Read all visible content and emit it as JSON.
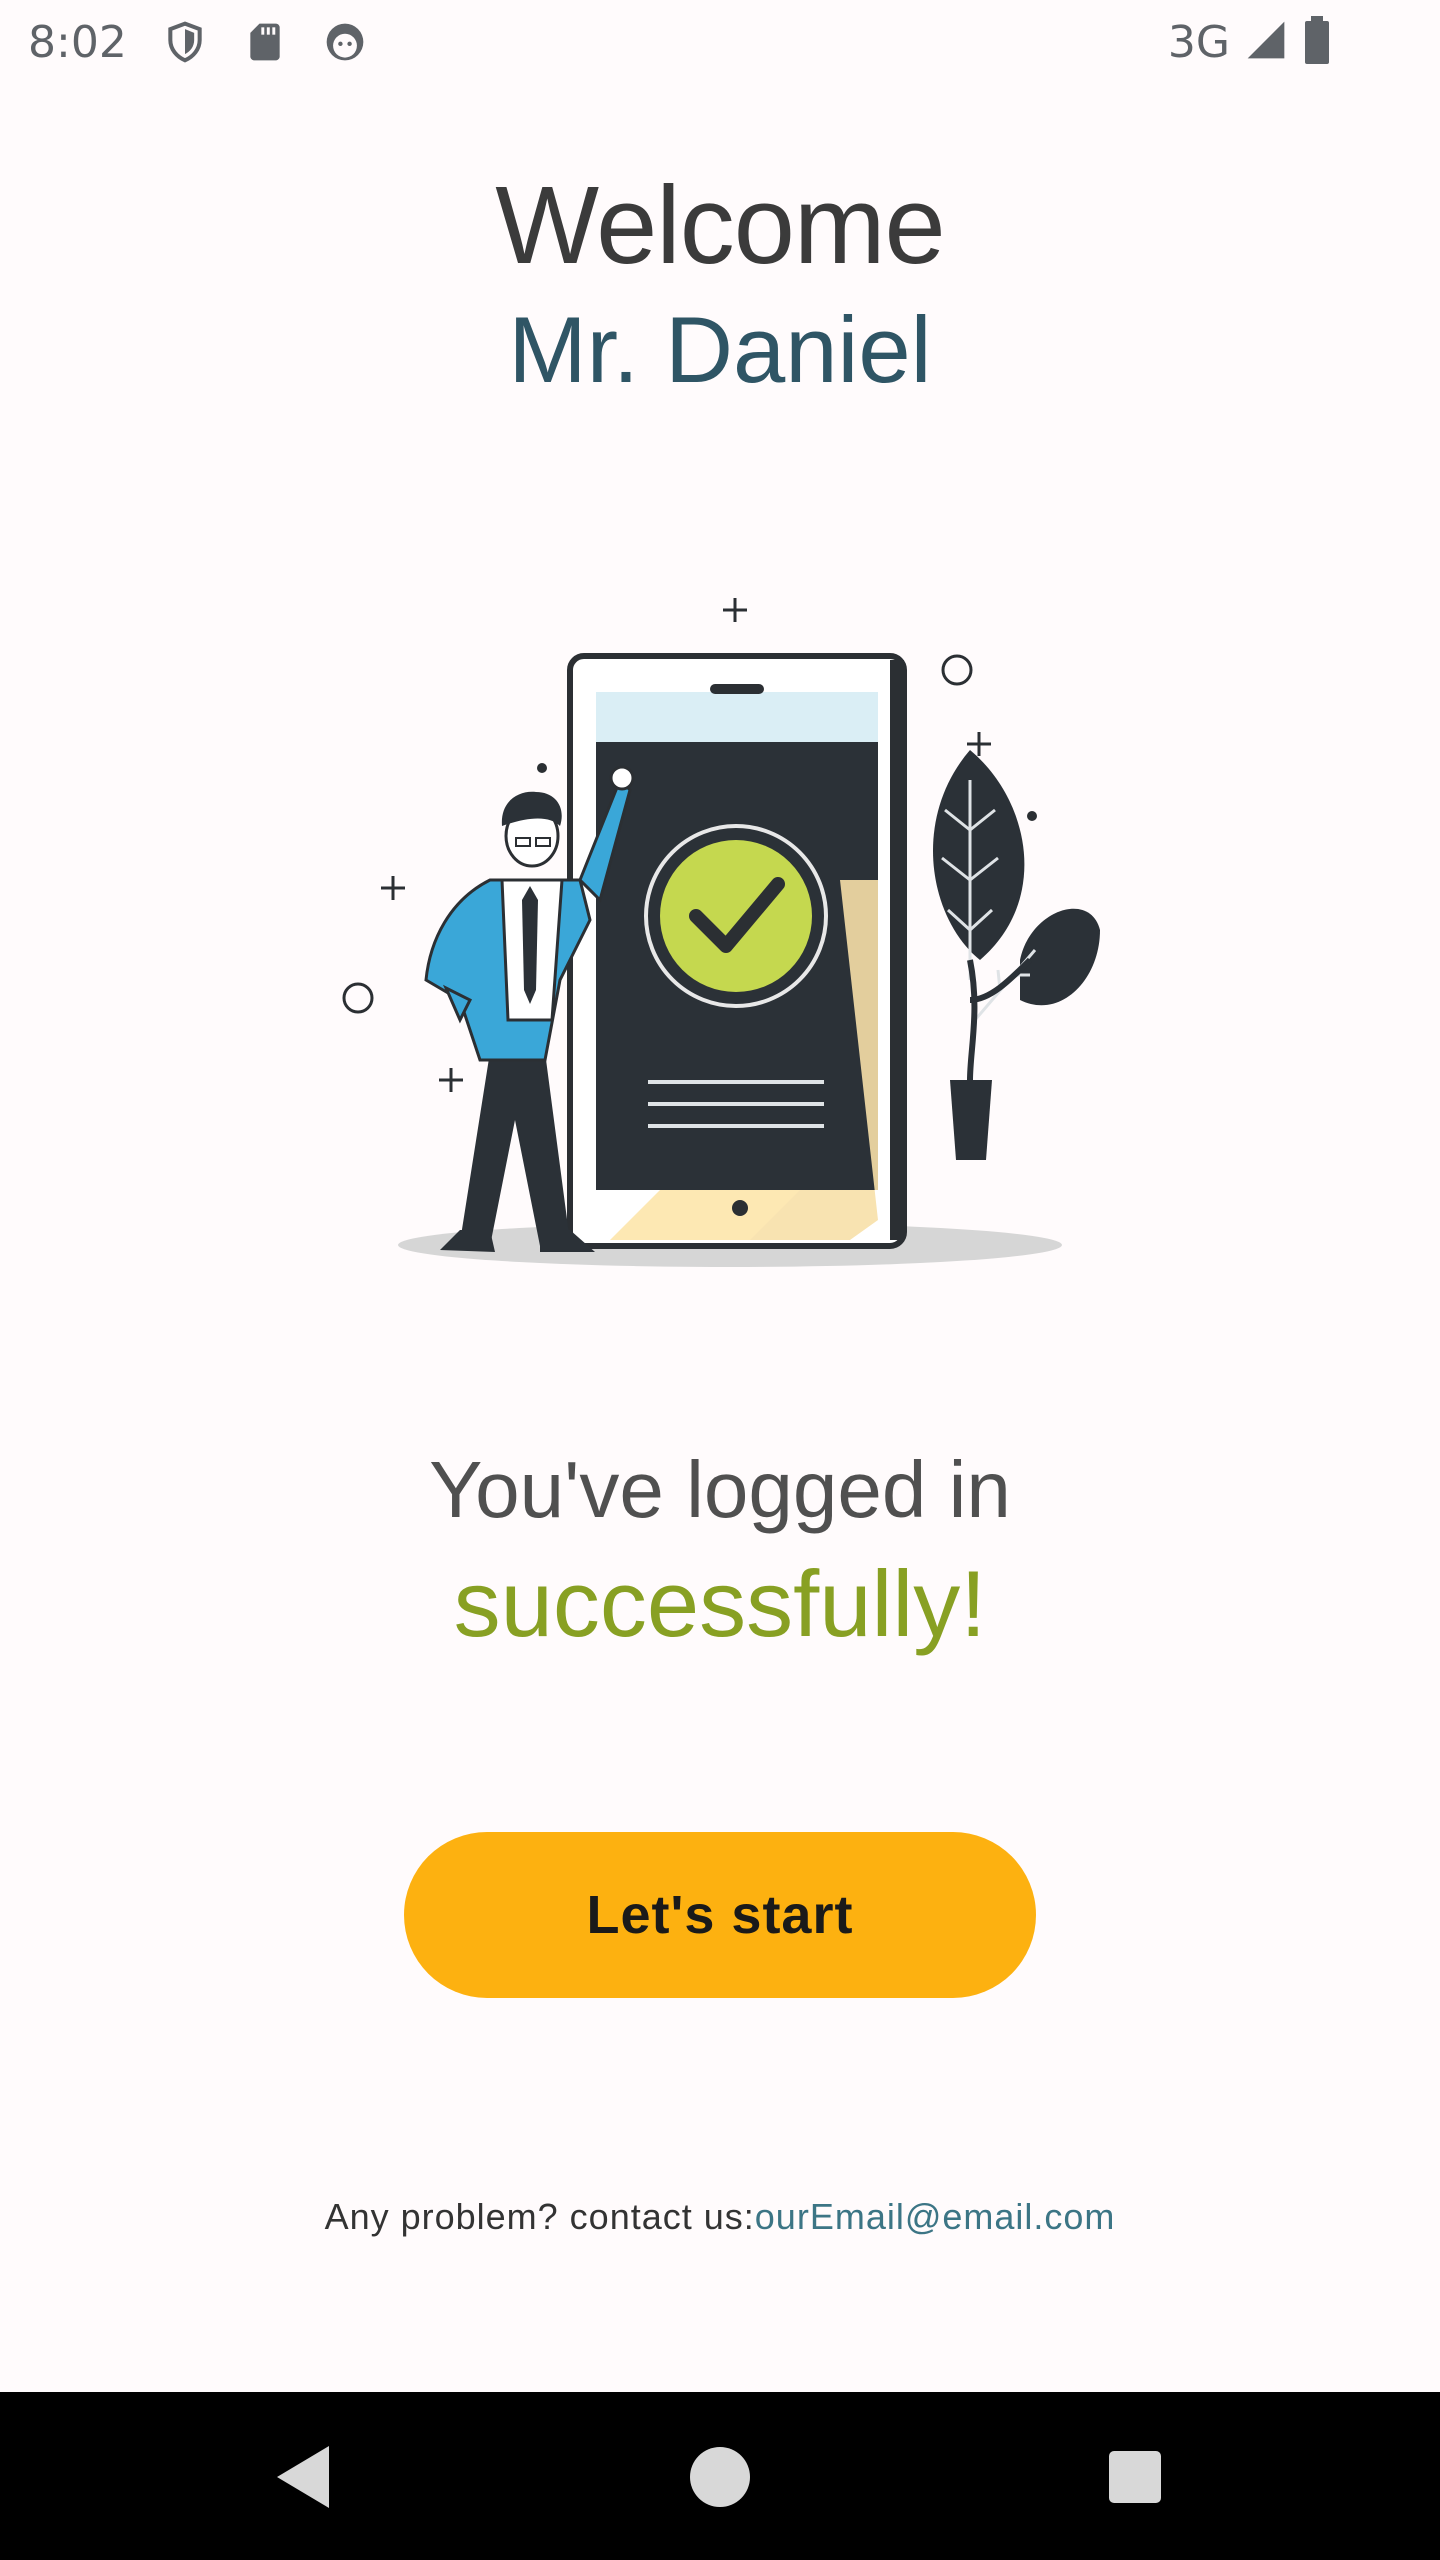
{
  "status_bar": {
    "time": "8:02",
    "network": "3G",
    "icons": [
      "shield-icon",
      "sd-card-icon",
      "android-face-icon",
      "signal-icon",
      "battery-icon"
    ]
  },
  "header": {
    "welcome": "Welcome",
    "user_name": "Mr. Daniel"
  },
  "message": {
    "line1": "You've logged in",
    "line2": "successfully!"
  },
  "actions": {
    "start_label": "Let's start"
  },
  "footer": {
    "prefix": "Any problem?  contact us:",
    "email": "ourEmail@email.com"
  },
  "colors": {
    "background": "#FFFBFC",
    "name": "#2F5565",
    "success": "#88A023",
    "button": "#FDB110",
    "link": "#3C7585"
  },
  "nav_bar": {
    "icons": [
      "back-icon",
      "home-icon",
      "recent-apps-icon"
    ]
  }
}
